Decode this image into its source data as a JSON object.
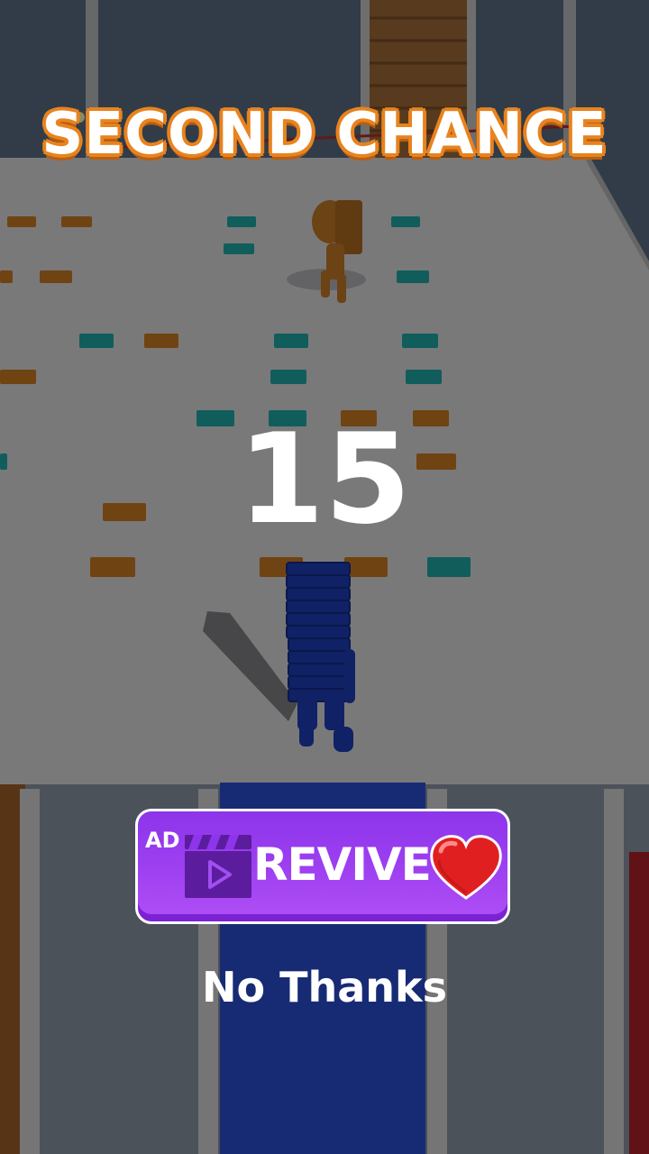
{
  "overlay": {
    "title": "SECOND CHANCE",
    "countdown": "15"
  },
  "revive_button": {
    "ad_label": "AD",
    "label": "REVIVE",
    "icon_left": "video-clapper-icon",
    "icon_right": "heart-icon",
    "color": "#9b3ef0"
  },
  "no_thanks_label": "No Thanks",
  "colors": {
    "title_outline": "#e8831f",
    "dim_overlay": "rgba(0,0,0,0.45)",
    "platform": "#6e6e70",
    "player": "#1c3aa8",
    "enemy": "#a8651c"
  }
}
